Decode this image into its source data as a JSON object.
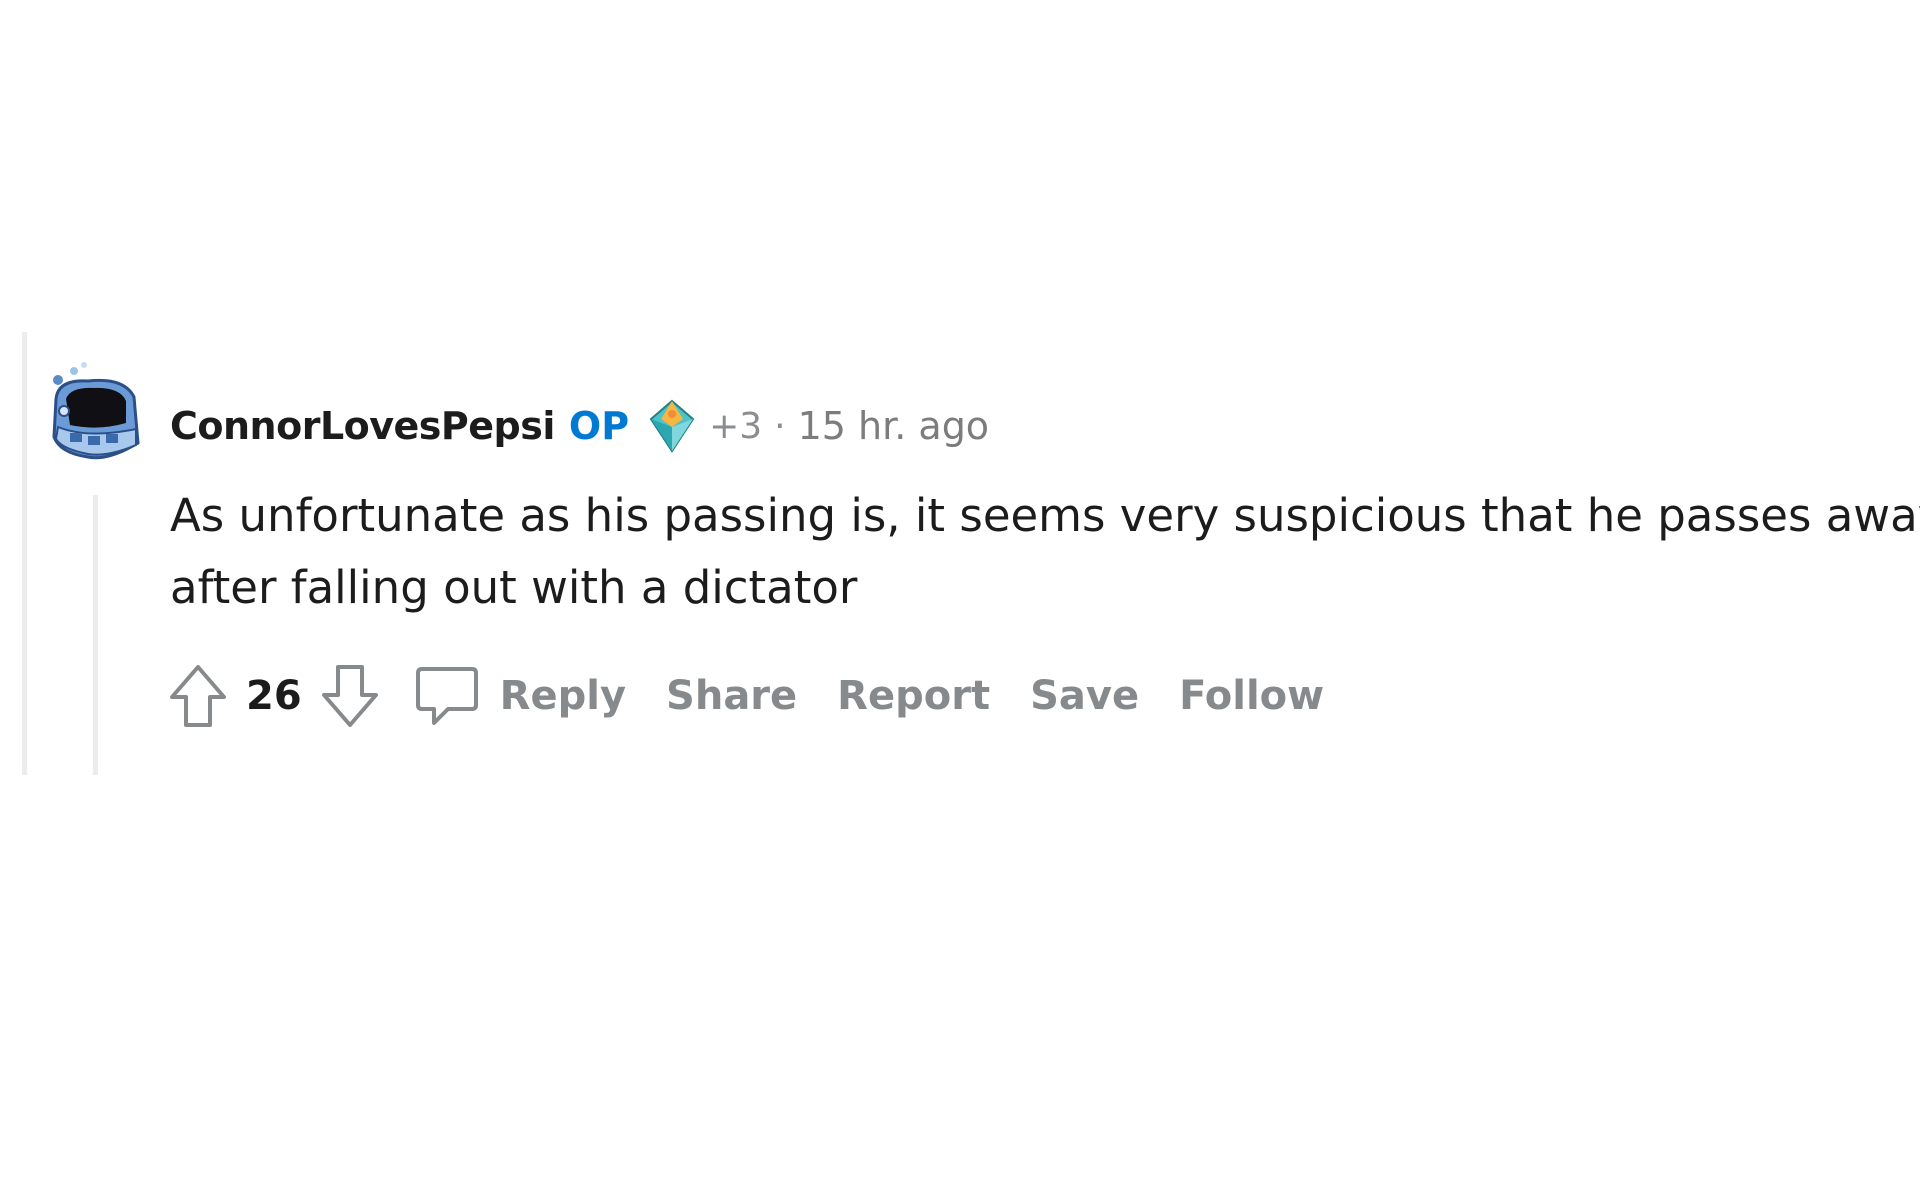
{
  "comment": {
    "username": "ConnorLovesPepsi",
    "op_badge": "OP",
    "flair_extra": "+3",
    "separator": "·",
    "timestamp": "15 hr. ago",
    "body": "As unfortunate as his passing is, it seems very suspicious that he passes away after falling out with a dictator",
    "score": "26",
    "actions": {
      "reply": "Reply",
      "share": "Share",
      "report": "Report",
      "save": "Save",
      "follow": "Follow"
    },
    "icons": {
      "avatar": "snoo-avatar",
      "flair": "award-icon",
      "upvote": "upvote-arrow-icon",
      "downvote": "downvote-arrow-icon",
      "reply": "speech-bubble-icon"
    },
    "colors": {
      "op": "#0079d3",
      "action_text": "#878a8c",
      "meta_text": "#7c7c7c",
      "thread_line": "#ececec"
    }
  }
}
